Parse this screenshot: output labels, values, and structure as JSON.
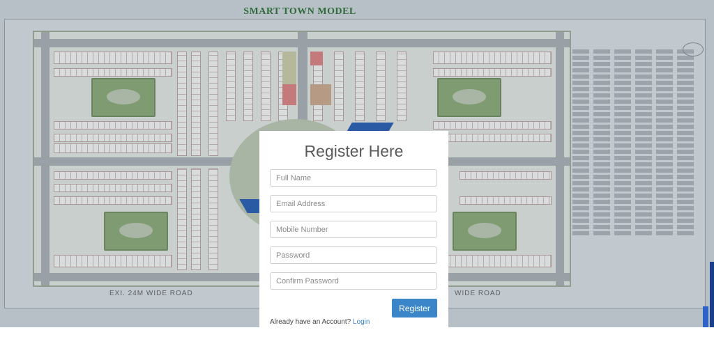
{
  "background": {
    "title": "SMART TOWN MODEL",
    "road_label_left": "EXI. 24M WIDE ROAD",
    "road_label_right": "WIDE ROAD"
  },
  "register": {
    "title": "Register Here",
    "fields": {
      "full_name": "Full Name",
      "email": "Email Address",
      "mobile": "Mobile Number",
      "password": "Password",
      "confirm_password": "Confirm Password"
    },
    "submit_label": "Register",
    "login_prompt": "Already have an Account?",
    "login_link": "Login"
  },
  "colors": {
    "button": "#3a86c8",
    "link": "#3a86c8",
    "title_green": "#2f6b3a"
  }
}
